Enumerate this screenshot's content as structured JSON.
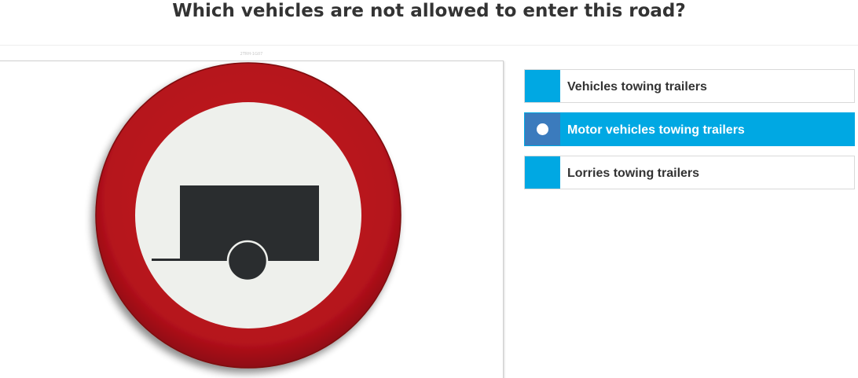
{
  "question": {
    "text": "Which vehicles are not allowed to enter this road?"
  },
  "image": {
    "caption": "2TRH-1G07",
    "sign": {
      "meaning": "no motor vehicles towing trailers",
      "colors": {
        "ring": "#b5121b",
        "face": "#eef0ec",
        "symbol": "#2a2d2f"
      },
      "icon": "trailer-icon"
    }
  },
  "answers": [
    {
      "label": "Vehicles towing trailers",
      "selected": false
    },
    {
      "label": "Motor vehicles towing trailers",
      "selected": true
    },
    {
      "label": "Lorries towing trailers",
      "selected": false
    }
  ],
  "colors": {
    "accent": "#00a8e3",
    "selected_marker": "#3b7bbd",
    "text": "#333333"
  }
}
